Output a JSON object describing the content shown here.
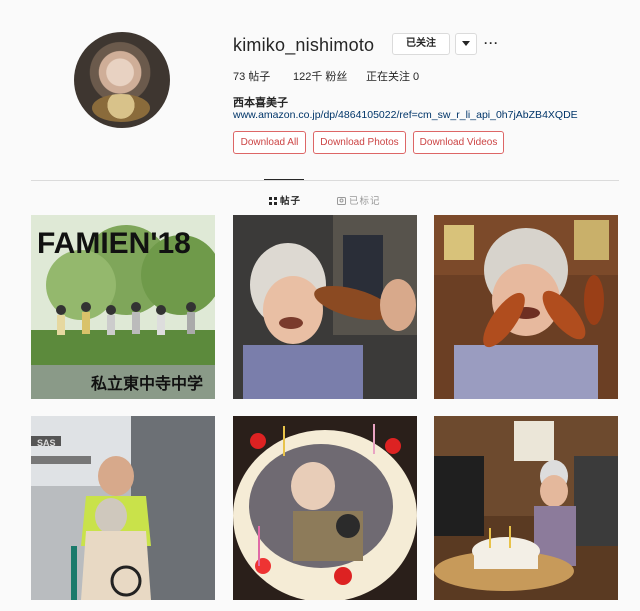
{
  "profile": {
    "username": "kimiko_nishimoto",
    "follow_button": "已关注",
    "more": "···",
    "full_name": "西本喜美子",
    "link": "www.amazon.co.jp/dp/4864105022/ref=cm_sw_r_li_api_0h7jAbZB4XQDE"
  },
  "stats": {
    "posts": "73 帖子",
    "followers": "122千 粉丝",
    "following": "正在关注 0"
  },
  "downloads": {
    "all": "Download All",
    "photos": "Download Photos",
    "videos": "Download Videos"
  },
  "tabs": {
    "posts": "帖子",
    "tagged": "已标记"
  },
  "posts": [
    {
      "caption_title": "FAMIEN'18",
      "caption_sub": "私立東中寺中学"
    },
    {
      "caption_title": ""
    },
    {
      "caption_title": ""
    },
    {
      "caption_title": "SAS"
    },
    {
      "caption_title": ""
    },
    {
      "caption_title": ""
    }
  ],
  "colors": {
    "accent_download": "#cc4444",
    "link": "#003569",
    "divider": "#dbdbdb"
  },
  "icons": {
    "grid": "grid-icon",
    "tag": "tag-icon",
    "dropdown": "chevron-down-icon",
    "more": "more-icon"
  }
}
